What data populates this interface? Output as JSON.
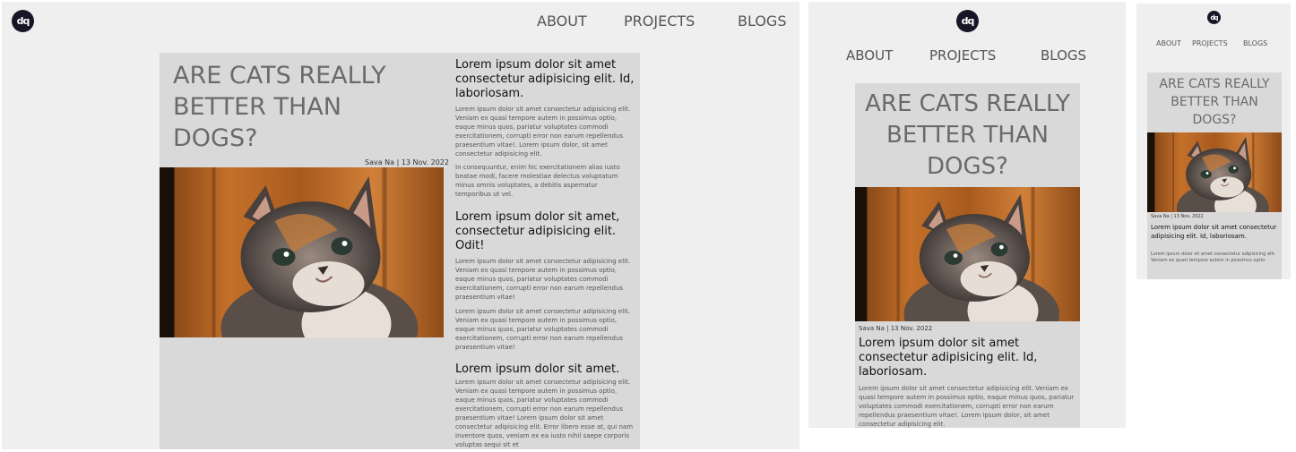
{
  "logo_text": "dq",
  "nav": [
    "ABOUT",
    "PROJECTS",
    "BLOGS"
  ],
  "article": {
    "title": "ARE CATS REALLY BETTER THAN DOGS?",
    "meta": "Sava Na | 13 Nov. 2022",
    "photo": "kitten-photo"
  },
  "sections": [
    {
      "heading": "Lorem ipsum dolor sit amet consectetur adipisicing elit. Id, laboriosam.",
      "paragraphs": [
        "Lorem ipsum dolor sit amet consectetur adipisicing elit. Veniam ex quasi tempore autem in possimus optio, eaque minus quos, pariatur voluptates commodi exercitationem, corrupti error non earum repellendus praesentium vitae!. Lorem ipsum dolor, sit amet consectetur adipisicing elit.",
        "In consequuntur, enim hic exercitationem alias iusto beatae modi, facere molestiae delectus voluptatum minus omnis voluptates, a debitis aspernatur temporibus ut vel."
      ]
    },
    {
      "heading": "Lorem ipsum dolor sit amet, consectetur adipisicing elit. Odit!",
      "paragraphs": [
        "Lorem ipsum dolor sit amet consectetur adipisicing elit. Veniam ex quasi tempore autem in possimus optio, eaque minus quos, pariatur voluptates commodi exercitationem, corrupti error non earum repellendus praesentium vitae!",
        "Lorem ipsum dolor sit amet consectetur adipisicing elit. Veniam ex quasi tempore autem in possimus optio, eaque minus quos, pariatur voluptates commodi exercitationem, corrupti error non earum repellendus praesentium vitae!"
      ]
    },
    {
      "heading": "Lorem ipsum dolor sit amet.",
      "paragraphs": [
        "Lorem ipsum dolor sit amet consectetur adipisicing elit. Veniam ex quasi tempore autem in possimus optio, eaque minus quos, pariatur voluptates commodi exercitationem, corrupti error non earum repellendus praesentium vitae! Lorem ipsum dolor sit amet consectetur adipisicing elit. Error libero esse at, qui nam inventore quos, veniam ex ea iusto nihil saepe corporis voluptas sequi sit et"
      ]
    }
  ],
  "tablet_paragraph": "Lorem ipsum dolor sit amet consectetur adipisicing elit. Veniam ex quasi tempore autem in possimus optio, eaque minus quos, pariatur voluptates commodi exercitationem, corrupti error non earum repellendus praesentium vitae!. Lorem ipsum dolor, sit amet consectetur adipisicing elit.",
  "mobile_paragraph": "Lorem ipsum dolor sit amet consectetur adipisicing elit. Veniam ex quasi tempore autem in possimus optio.",
  "colors": {
    "page_bg": "#efefef",
    "card_bg": "#d9d9d9",
    "title": "#6a6a6a",
    "nav": "#555555",
    "logo_bg": "#161626"
  }
}
